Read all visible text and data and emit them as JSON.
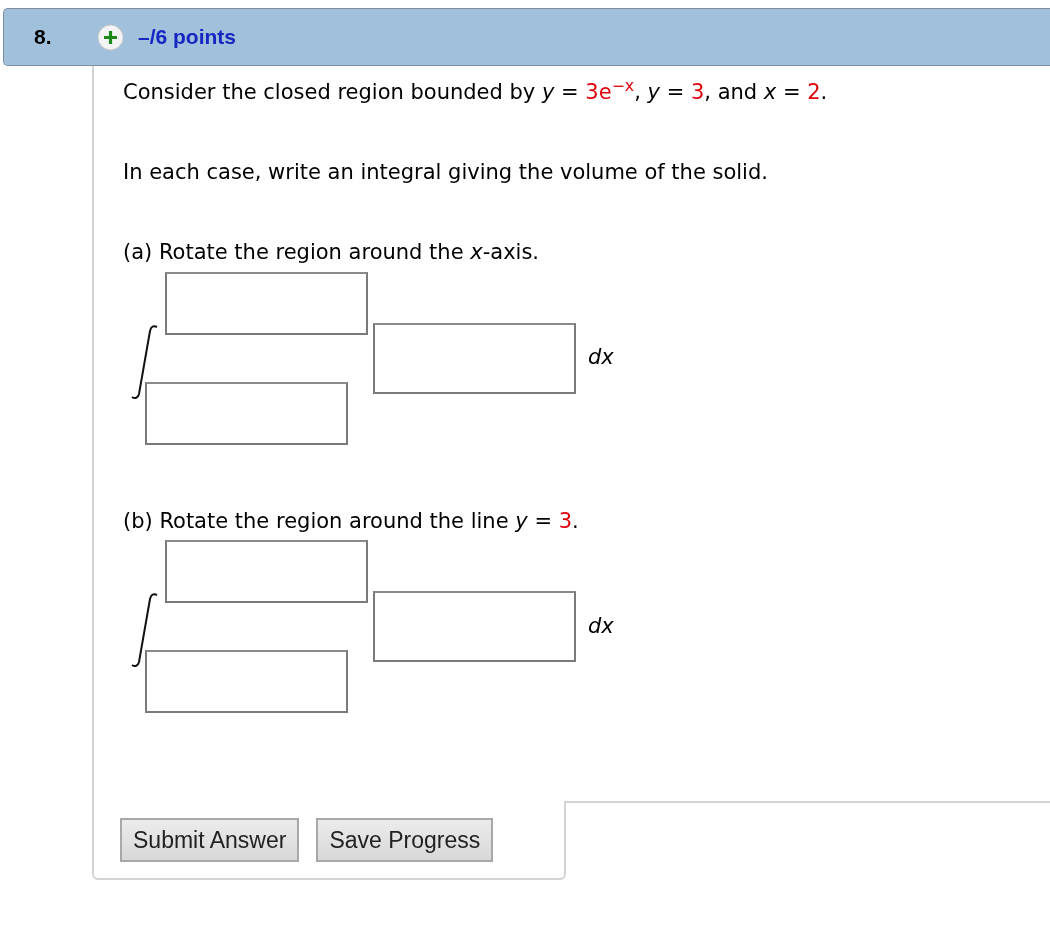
{
  "header": {
    "number": "8.",
    "points": "–/6 points"
  },
  "statement": [
    {
      "kind": "plain",
      "text": "Consider the closed region bounded by  *y* = "
    },
    {
      "kind": "value",
      "text": "3e$^{−x}$"
    },
    {
      "kind": "plain",
      "text": ", *y* = "
    },
    {
      "kind": "value",
      "text": "3"
    },
    {
      "kind": "plain",
      "text": ", and *x* = "
    },
    {
      "kind": "value",
      "text": "2"
    },
    {
      "kind": "plain",
      "text": "."
    }
  ],
  "instruction": "In each case, write an integral giving the volume of the solid.",
  "parts": [
    {
      "prompt": [
        {
          "kind": "plain",
          "text": "(a) Rotate the region around the *x*-axis."
        }
      ],
      "differential": "*dx*"
    },
    {
      "prompt": [
        {
          "kind": "plain",
          "text": "(b) Rotate the region around the line *y* = "
        },
        {
          "kind": "value",
          "text": "3"
        },
        {
          "kind": "plain",
          "text": "."
        }
      ],
      "differential": "*dx*"
    }
  ],
  "buttons": [
    "Submit Answer",
    "Save Progress"
  ]
}
